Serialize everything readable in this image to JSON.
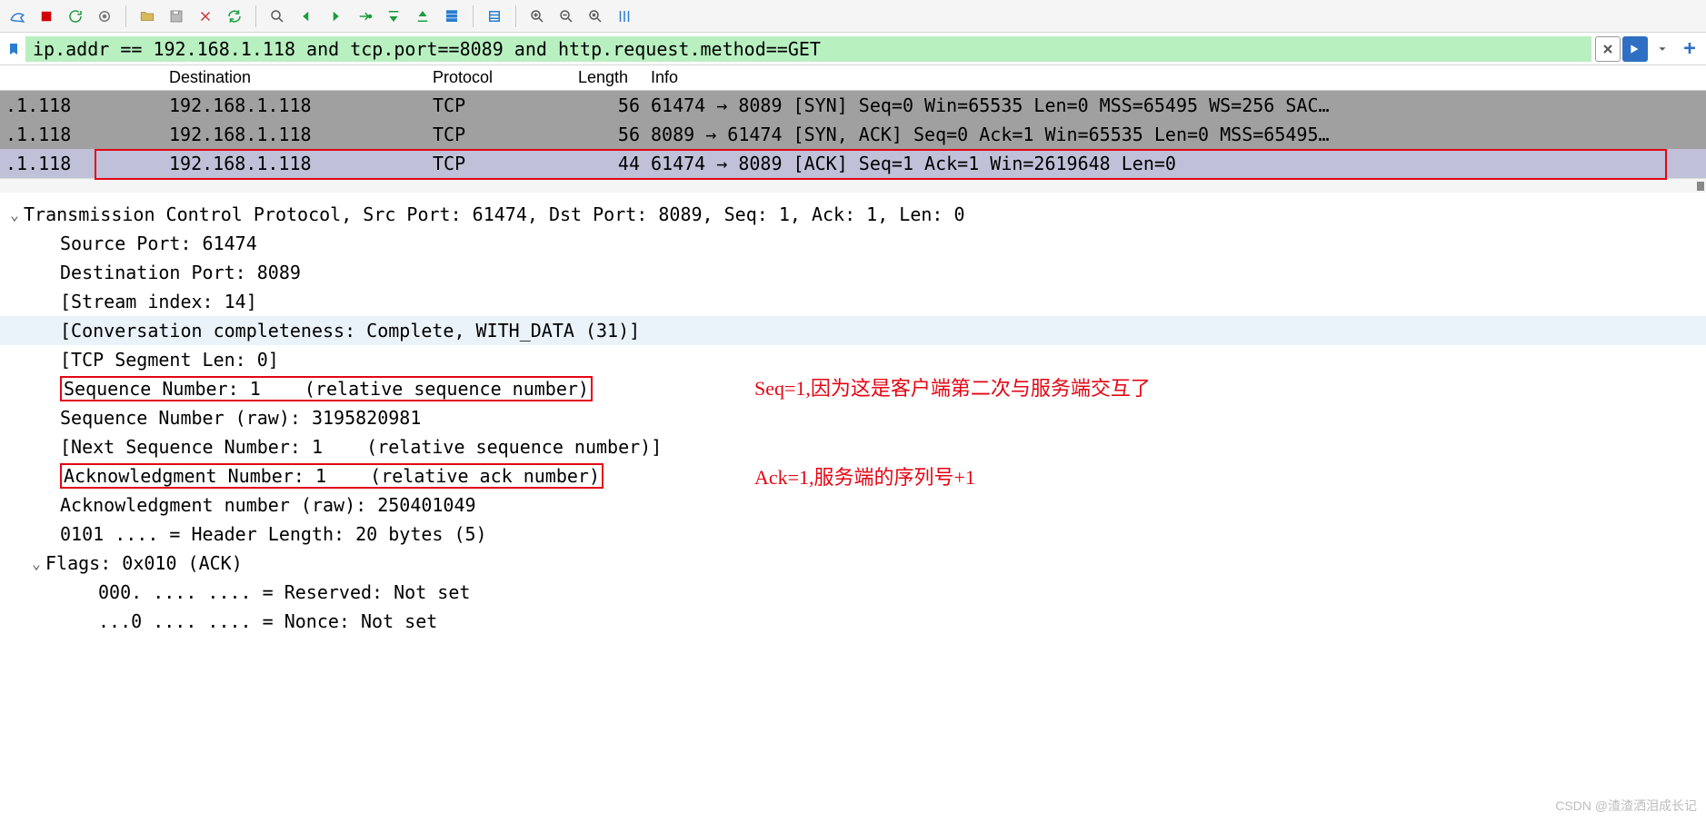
{
  "toolbar": {
    "icons": [
      "shark-icon",
      "stop-icon",
      "restart-icon",
      "options-icon",
      "open-icon",
      "save-icon",
      "close-file-icon",
      "reload-icon",
      "find-icon",
      "prev-icon",
      "next-icon",
      "jump-icon",
      "top-icon",
      "bottom-icon",
      "autoscroll-icon",
      "colorize-icon",
      "zoom-in-icon",
      "zoom-out-icon",
      "zoom-reset-icon",
      "resize-cols-icon"
    ]
  },
  "filter": {
    "value": "ip.addr == 192.168.1.118 and tcp.port==8089 and http.request.method==GET"
  },
  "plist": {
    "headers": [
      "",
      "Destination",
      "Protocol",
      "Length",
      "Info"
    ],
    "rows": [
      {
        "class": "grey",
        "source": ".1.118",
        "dest": "192.168.1.118",
        "proto": "TCP",
        "len": "56",
        "info": "61474 → 8089 [SYN] Seq=0 Win=65535 Len=0 MSS=65495 WS=256 SAC…"
      },
      {
        "class": "grey",
        "source": ".1.118",
        "dest": "192.168.1.118",
        "proto": "TCP",
        "len": "56",
        "info": "8089 → 61474 [SYN, ACK] Seq=0 Ack=1 Win=65535 Len=0 MSS=65495…"
      },
      {
        "class": "sel",
        "source": ".1.118",
        "dest": "192.168.1.118",
        "proto": "TCP",
        "len": "44",
        "info": "61474 → 8089 [ACK] Seq=1 Ack=1 Win=2619648 Len=0"
      }
    ]
  },
  "details": {
    "header": "Transmission Control Protocol, Src Port: 61474, Dst Port: 8089, Seq: 1, Ack: 1, Len: 0",
    "src_port": "Source Port: 61474",
    "dst_port": "Destination Port: 8089",
    "stream_index": "[Stream index: 14]",
    "conv_complete": "[Conversation completeness: Complete, WITH_DATA (31)]",
    "seg_len": "[TCP Segment Len: 0]",
    "seq_rel": "Sequence Number: 1    (relative sequence number)",
    "seq_raw": "Sequence Number (raw): 3195820981",
    "next_seq": "[Next Sequence Number: 1    (relative sequence number)]",
    "ack_rel": "Acknowledgment Number: 1    (relative ack number)",
    "ack_raw": "Acknowledgment number (raw): 250401049",
    "hlen": "0101 .... = Header Length: 20 bytes (5)",
    "flags_header": "Flags: 0x010 (ACK)",
    "flag_reserved": "000. .... .... = Reserved: Not set",
    "flag_nonce": "...0 .... .... = Nonce: Not set"
  },
  "annotations": {
    "seq_note": "Seq=1,因为这是客户端第二次与服务端交互了",
    "ack_note": "Ack=1,服务端的序列号+1"
  },
  "watermark": "CSDN @渣渣洒泪成长记"
}
